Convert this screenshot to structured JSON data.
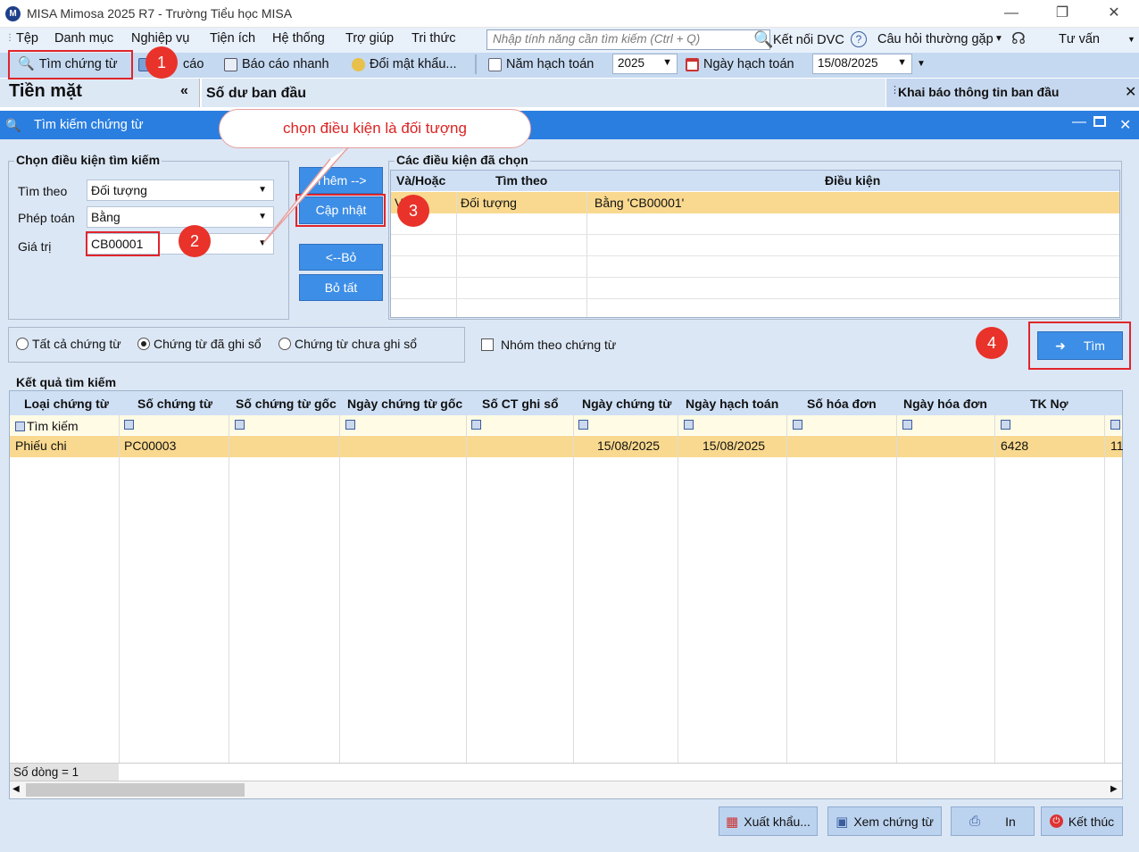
{
  "window": {
    "title": "MISA Mimosa 2025 R7 - Trường Tiểu học MISA",
    "logo_icon": "misa-logo-icon"
  },
  "menu": {
    "items": [
      "Tệp",
      "Danh mục",
      "Nghiệp vụ",
      "Tiện ích",
      "Hệ thống",
      "Trợ giúp",
      "Tri thức"
    ],
    "search_placeholder": "Nhập tính năng cần tìm kiếm (Ctrl + Q)",
    "connect_label": "Kết nối DVC",
    "faq_label": "Câu hỏi thường gặp",
    "consult_label": "Tư vấn"
  },
  "toolbar": {
    "find_voucher": "Tìm chứng từ",
    "report": "cáo",
    "quick_report": "Báo cáo nhanh",
    "change_password": "Đổi mật khẩu...",
    "fiscal_year_label": "Năm hạch toán",
    "fiscal_year_value": "2025",
    "posting_date_label": "Ngày hạch toán",
    "posting_date_value": "15/08/2025"
  },
  "left_panel": {
    "title": "Tiền mặt",
    "collapse": "«"
  },
  "tabs": {
    "active": "Số dư ban đầu",
    "right_panel": "Khai báo thông tin ban đầu"
  },
  "dialog": {
    "title": "Tìm kiếm chứng từ",
    "criteria_group": "Chọn điều kiện tìm kiếm",
    "search_by_label": "Tìm theo",
    "search_by_value": "Đối tượng",
    "operator_label": "Phép toán",
    "operator_value": "Bằng",
    "value_label": "Giá trị",
    "value_value": "CB00001",
    "btn_add": "Thêm -->",
    "btn_update": "Cập nhật",
    "btn_remove": "<--Bỏ",
    "btn_remove_all": "Bỏ tất",
    "selected_group": "Các điều kiện đã chọn",
    "selected_headers": [
      "Và/Hoặc",
      "Tìm theo",
      "Điều kiện"
    ],
    "selected_rows": [
      {
        "andor": "Và",
        "field": "Đối tượng",
        "condition": "Bằng 'CB00001'"
      }
    ],
    "radio_all": "Tất cả chứng từ",
    "radio_posted": "Chứng từ đã ghi sổ",
    "radio_unposted": "Chứng từ chưa ghi sổ",
    "group_by_voucher": "Nhóm theo chứng từ",
    "btn_search": "Tìm",
    "results_group": "Kết quả tìm kiếm",
    "results_headers": [
      "Loại chứng từ",
      "Số chứng từ",
      "Số chứng từ gốc",
      "Ngày chứng từ gốc",
      "Số CT ghi sổ",
      "Ngày chứng từ",
      "Ngày hạch toán",
      "Số hóa đơn",
      "Ngày hóa đơn",
      "TK Nợ"
    ],
    "filter_label": "Tìm kiếm",
    "results_rows": [
      {
        "type": "Phiếu chi",
        "number": "PC00003",
        "orig_no": "",
        "orig_date": "",
        "book_no": "",
        "doc_date": "15/08/2025",
        "post_date": "15/08/2025",
        "inv_no": "",
        "inv_date": "",
        "debit": "6428",
        "credit_partial": "11"
      }
    ],
    "row_count": "Số dòng = 1",
    "footer": {
      "export": "Xuất khẩu...",
      "view": "Xem chứng từ",
      "print": "In",
      "close": "Kết thúc"
    }
  },
  "annotations": {
    "callout": "chọn  điều kiện là đối tượng",
    "steps": [
      "1",
      "2",
      "3",
      "4"
    ]
  },
  "colors": {
    "dialog_title": "#2a7ee0",
    "highlight_row": "#f9d98f",
    "badge": "#e8322a"
  }
}
